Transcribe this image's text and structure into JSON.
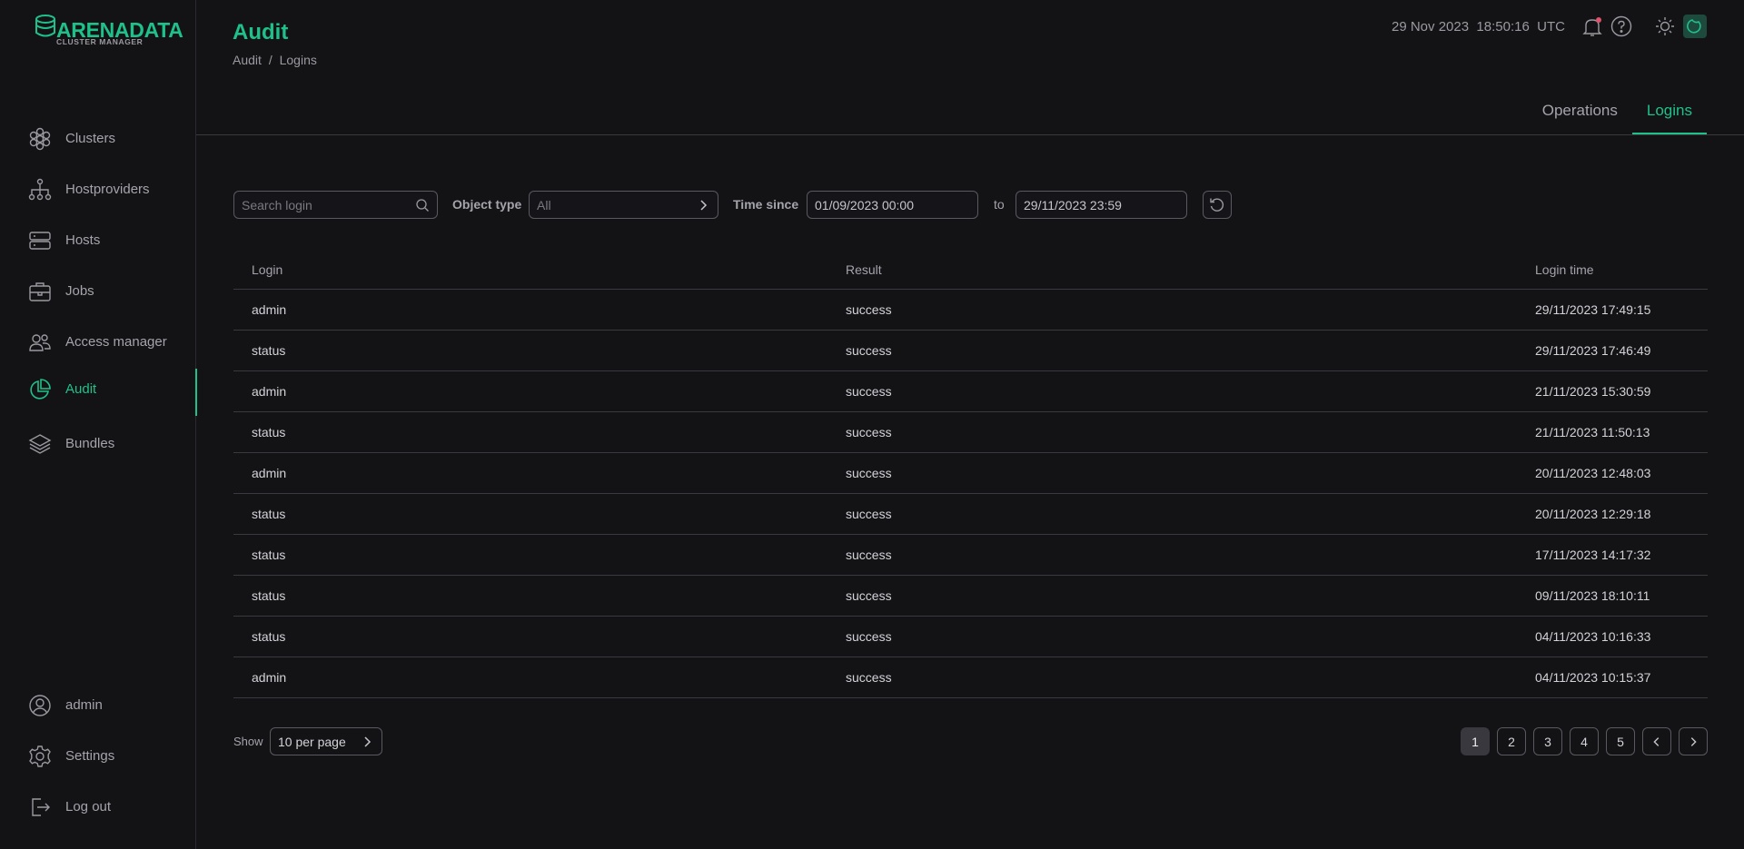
{
  "brand": {
    "name": "ARENADATA",
    "sub": "CLUSTER MANAGER",
    "accent": "#1fc18a"
  },
  "sidebar": {
    "items": [
      {
        "label": "Clusters",
        "icon": "clusters-icon"
      },
      {
        "label": "Hostproviders",
        "icon": "hostproviders-icon"
      },
      {
        "label": "Hosts",
        "icon": "hosts-icon"
      },
      {
        "label": "Jobs",
        "icon": "jobs-icon"
      },
      {
        "label": "Access manager",
        "icon": "access-manager-icon"
      },
      {
        "label": "Audit",
        "icon": "audit-icon",
        "active": true
      },
      {
        "label": "Bundles",
        "icon": "bundles-icon"
      }
    ],
    "bottom": [
      {
        "label": "admin",
        "icon": "user-icon"
      },
      {
        "label": "Settings",
        "icon": "gear-icon"
      },
      {
        "label": "Log out",
        "icon": "logout-icon"
      }
    ]
  },
  "header": {
    "title": "Audit",
    "breadcrumb": [
      "Audit",
      "Logins"
    ],
    "breadcrumb_sep": "/",
    "date": "29 Nov 2023",
    "time": "18:50:16",
    "tz": "UTC"
  },
  "tabs": [
    {
      "label": "Operations"
    },
    {
      "label": "Logins",
      "active": true
    }
  ],
  "filters": {
    "search_placeholder": "Search login",
    "object_type_label": "Object type",
    "object_type_value": "All",
    "time_since_label": "Time since",
    "time_since_value": "01/09/2023 00:00",
    "to_label": "to",
    "time_to_value": "29/11/2023 23:59"
  },
  "table": {
    "columns": [
      "Login",
      "Result",
      "Login time"
    ],
    "rows": [
      {
        "login": "admin",
        "result": "success",
        "time": "29/11/2023 17:49:15"
      },
      {
        "login": "status",
        "result": "success",
        "time": "29/11/2023 17:46:49"
      },
      {
        "login": "admin",
        "result": "success",
        "time": "21/11/2023 15:30:59"
      },
      {
        "login": "status",
        "result": "success",
        "time": "21/11/2023 11:50:13"
      },
      {
        "login": "admin",
        "result": "success",
        "time": "20/11/2023 12:48:03"
      },
      {
        "login": "status",
        "result": "success",
        "time": "20/11/2023 12:29:18"
      },
      {
        "login": "status",
        "result": "success",
        "time": "17/11/2023 14:17:32"
      },
      {
        "login": "status",
        "result": "success",
        "time": "09/11/2023 18:10:11"
      },
      {
        "login": "status",
        "result": "success",
        "time": "04/11/2023 10:16:33"
      },
      {
        "login": "admin",
        "result": "success",
        "time": "04/11/2023 10:15:37"
      }
    ]
  },
  "pagination": {
    "show_label": "Show",
    "per_page": "10 per page",
    "pages": [
      "1",
      "2",
      "3",
      "4",
      "5"
    ],
    "current": "1"
  }
}
